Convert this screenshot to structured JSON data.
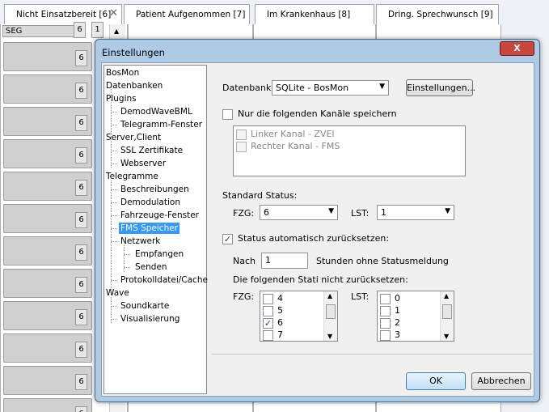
{
  "background": {
    "tabs": [
      {
        "label": "Nicht Einsatzbereit [6]"
      },
      {
        "label": "Patient Aufgenommen [7]"
      },
      {
        "label": "Im Krankenhaus [8]"
      },
      {
        "label": "Dring. Sprechwunsch [9]"
      }
    ],
    "close_glyph": "✕",
    "seg_label": "SEG",
    "seg_values": [
      "6",
      "1"
    ],
    "row_values": [
      "6",
      "6",
      "6",
      "6",
      "6",
      "6",
      "6",
      "6",
      "6",
      "6",
      "6",
      "6"
    ]
  },
  "dialog": {
    "title": "Einstellungen",
    "close": "X",
    "tree": {
      "bosmon": "BosMon",
      "datenbanken": "Datenbanken",
      "plugins": "Plugins",
      "demodwavebml": "DemodWaveBML",
      "telegramm_fenster": "Telegramm-Fenster",
      "server_client": "Server,Client",
      "ssl": "SSL Zertifikate",
      "webserver": "Webserver",
      "telegramme": "Telegramme",
      "beschreibungen": "Beschreibungen",
      "demodulation": "Demodulation",
      "fahrzeuge": "Fahrzeuge-Fenster",
      "fms_speicher": "FMS Speicher",
      "netzwerk": "Netzwerk",
      "empfangen": "Empfangen",
      "senden": "Senden",
      "protokoll": "Protokolldatei/Cache",
      "wave": "Wave",
      "soundkarte": "Soundkarte",
      "visualisierung": "Visualisierung"
    },
    "datenbank_label": "Datenbank:",
    "datenbank_value": "SQLite - BosMon",
    "einstellungen_button": "Einstellungen...",
    "nur_kanaele_label": "Nur die folgenden Kanäle speichern",
    "kanaele": [
      "Linker Kanal - ZVEI",
      "Rechter Kanal - FMS"
    ],
    "standard_status_label": "Standard Status:",
    "fzg_label": "FZG:",
    "fzg_value": "6",
    "lst_label": "LST:",
    "lst_value": "1",
    "auto_reset_label": "Status automatisch zurücksetzen:",
    "auto_reset_checked": true,
    "nach_label": "Nach",
    "nach_value": "1",
    "stunden_label": "Stunden ohne Statusmeldung",
    "nicht_reset_label": "Die folgenden Stati nicht zurücksetzen:",
    "fzg_list_label": "FZG:",
    "lst_list_label": "LST:",
    "fzg_list": [
      "4",
      "5",
      "6",
      "7"
    ],
    "fzg_checked": "6",
    "lst_list": [
      "0",
      "1",
      "2",
      "3"
    ],
    "ok_button": "OK",
    "cancel_button": "Abbrechen"
  }
}
